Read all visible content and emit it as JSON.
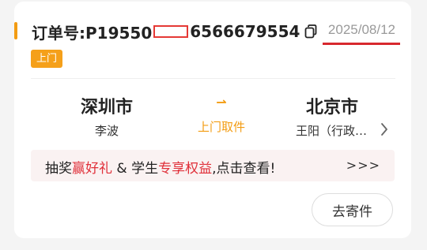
{
  "order": {
    "label_prefix": "订单号:P19550",
    "label_suffix": "6566679554",
    "date": "2025/08/12",
    "badge": "上门"
  },
  "route": {
    "from_city": "深圳市",
    "from_name": "李波",
    "arrow": "⇀",
    "mode_label": "上门取件",
    "to_city": "北京市",
    "to_name": "王阳（行政…"
  },
  "promo": {
    "text_1": "抽奖",
    "text_red_1": "赢好礼",
    "text_2": " & 学生",
    "text_red_2": "专享权益",
    "text_3": ",点击查看!",
    "more": ">>>"
  },
  "actions": {
    "send_label": "去寄件"
  },
  "colors": {
    "accent": "#f39c12",
    "promo_red": "#e0303a",
    "redaction_red": "#e53935"
  },
  "icons": {
    "copy": "copy-icon",
    "chevron": "chevron-right-icon"
  }
}
